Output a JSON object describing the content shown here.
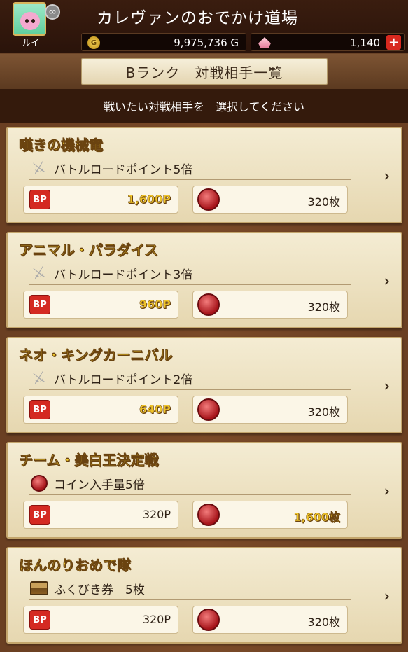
{
  "header": {
    "player_name": "ルイ",
    "title": "カレヴァンのおでかけ道場",
    "gold": "9,975,736 G",
    "gold_icon_label": "G",
    "gems": "1,140",
    "plus_label": "+"
  },
  "rank": {
    "heading": "Bランク　対戦相手一覧",
    "instruction": "戦いたい対戦相手を　選択してください"
  },
  "opponents": [
    {
      "name": "嘆きの機械竜",
      "bonus_icon": "sword-icon",
      "bonus": "バトルロードポイント5倍",
      "bp": "1,600P",
      "bp_highlight": true,
      "coins": "320枚",
      "coins_highlight": false
    },
    {
      "name": "アニマル・パラダイス",
      "bonus_icon": "sword-icon",
      "bonus": "バトルロードポイント3倍",
      "bp": "960P",
      "bp_highlight": true,
      "coins": "320枚",
      "coins_highlight": false
    },
    {
      "name": "ネオ・キングカーニバル",
      "bonus_icon": "sword-icon",
      "bonus": "バトルロードポイント2倍",
      "bp": "640P",
      "bp_highlight": true,
      "coins": "320枚",
      "coins_highlight": false
    },
    {
      "name": "チーム・美白王決定戦",
      "bonus_icon": "coin-icon",
      "bonus": "コイン入手量5倍",
      "bp": "320P",
      "bp_highlight": false,
      "coins": "1,600枚",
      "coins_highlight": true
    },
    {
      "name": "ほんのりおめで隊",
      "bonus_icon": "treasure-chest-icon",
      "bonus": "ふくびき券　5枚",
      "bp": "320P",
      "bp_highlight": false,
      "coins": "320枚",
      "coins_highlight": false
    }
  ],
  "labels": {
    "bp_badge": "BP",
    "chevron": "›"
  },
  "colors": {
    "highlight_text": "#f0c52a",
    "bp_badge": "#d42a22",
    "plus_button": "#d8291f"
  }
}
